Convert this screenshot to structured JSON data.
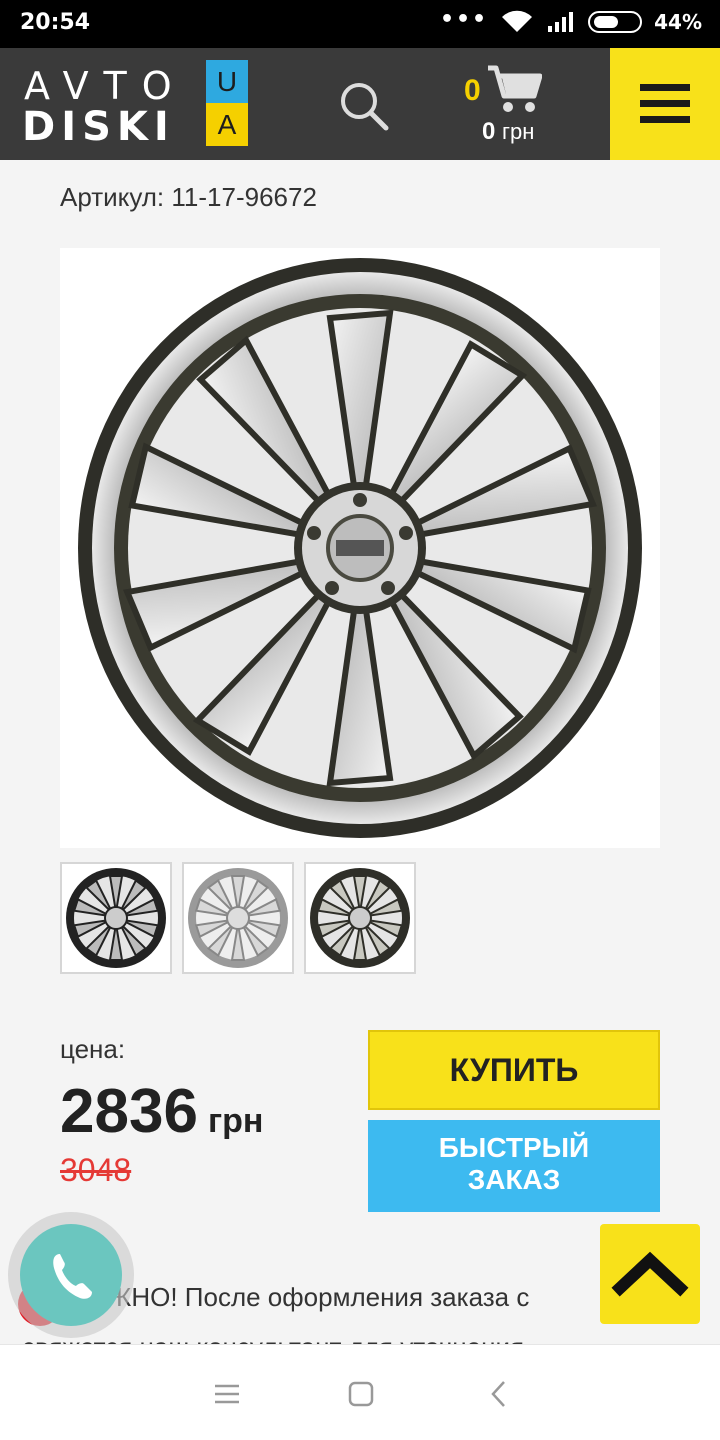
{
  "status_bar": {
    "time": "20:54",
    "battery": "44%"
  },
  "header": {
    "logo_top": "AVTO",
    "logo_bottom": "DISKI",
    "logo_flag_top": "U",
    "logo_flag_bottom": "A",
    "cart_count": "0",
    "cart_sum": "0",
    "cart_currency": "грн",
    "icons": [
      "search-icon",
      "cart-icon",
      "menu-icon"
    ]
  },
  "product": {
    "article": "Артикул: 11-17-96672",
    "price_label": "цена:",
    "price": "2836",
    "currency": "грн",
    "old_price": "3048",
    "buy_label": "КУПИТЬ",
    "quick_order_line1": "БЫСТРЫЙ",
    "quick_order_line2": "ЗАКАЗ"
  },
  "notice": {
    "text": "АЖНО! После оформления заказа с",
    "text_line2": "свяжется наш консультант для уточнения"
  },
  "colors": {
    "accent_yellow": "#f8e11a",
    "header_bg": "#3a3a3a",
    "quick_blue": "#3dbaf0",
    "old_price_red": "#e53935",
    "call_teal": "#6bc6bf"
  }
}
